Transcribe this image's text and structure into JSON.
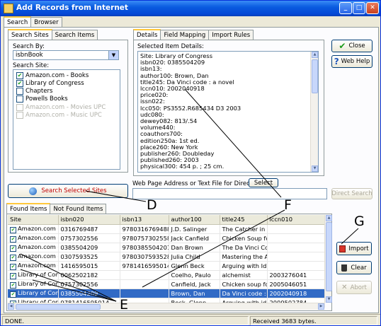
{
  "window": {
    "title": "Add Records from Internet"
  },
  "main_tabs": [
    "Search",
    "Browser"
  ],
  "search_tabs": [
    "Search Sites",
    "Search Items"
  ],
  "search_by": {
    "label": "Search By:",
    "value": "isbnBook"
  },
  "search_site": {
    "label": "Search Site:",
    "sites": [
      {
        "name": "Amazon.com - Books",
        "checked": "✔",
        "enabled": true
      },
      {
        "name": "Library of Congress",
        "checked": "✔",
        "enabled": true
      },
      {
        "name": "Chapters",
        "checked": "",
        "enabled": true
      },
      {
        "name": "Powells Books",
        "checked": "",
        "enabled": true
      },
      {
        "name": "Amazon.com - Movies UPC",
        "checked": "",
        "enabled": false
      },
      {
        "name": "Amazon.com - Music UPC",
        "checked": "",
        "enabled": false
      }
    ]
  },
  "detail_tabs": [
    "Details",
    "Field Mapping",
    "Import Rules"
  ],
  "details": {
    "label": "Selected Item Details:",
    "lines": [
      "Site: Library of Congress",
      "isbn020: 0385504209",
      "isbn13:",
      "author100: Brown, Dan",
      "title245: Da Vinci code : a novel",
      "lccn010: 2002040918",
      "price020:",
      "issn022:",
      "lcc050: PS3552.R685434 D3 2003",
      "udc080:",
      "dewey082: 813/.54",
      "volume440:",
      "coauthors700:",
      "edition250a: 1st ed.",
      "place260: New York",
      "publisher260: Doubleday",
      "published260: 2003",
      "physical300: 454 p. ; 25 cm."
    ]
  },
  "buttons": {
    "close": "Close",
    "web_help": "Web Help",
    "search_selected": "Search Selected Sites",
    "select": "Select",
    "direct_search": "Direct Search",
    "import": "Import",
    "clear": "Clear",
    "abort": "Abort"
  },
  "direct_search": {
    "label": "Web Page Address or Text File for Direct Search:",
    "value": ""
  },
  "result_tabs": [
    "Found Items",
    "Not Found Items"
  ],
  "results": {
    "columns": [
      "Site",
      "isbn020",
      "isbn13",
      "author100",
      "title245",
      "lccn010"
    ],
    "rows": [
      {
        "check": "✔",
        "cells": [
          "Amazon.com -...",
          "0316769487",
          "9780316769488",
          "J.D. Salinger",
          "The Catcher in t...",
          ""
        ],
        "selected": false
      },
      {
        "check": "✔",
        "cells": [
          "Amazon.com -...",
          "0757302556",
          "9780757302558",
          "Jack Canfield",
          "Chicken Soup fo...",
          ""
        ],
        "selected": false
      },
      {
        "check": "✔",
        "cells": [
          "Amazon.com -...",
          "0385504209",
          "9780385504201",
          "Dan Brown",
          "The Da Vinci Co...",
          ""
        ],
        "selected": false
      },
      {
        "check": "✔",
        "cells": [
          "Amazon.com -...",
          "0307593525",
          "9780307593528",
          "Julia Child",
          "Mastering the Ar...",
          ""
        ],
        "selected": false
      },
      {
        "check": "✔",
        "cells": [
          "Amazon.com -...",
          "1416595015",
          "9781416595014",
          "Glenn Beck",
          "Arguing with Idio...",
          ""
        ],
        "selected": false
      },
      {
        "check": "✔",
        "cells": [
          "Library of Con...",
          "0062502182",
          "",
          "Coelho, Paulo",
          "alchemist",
          "2003276041"
        ],
        "selected": false
      },
      {
        "check": "✔",
        "cells": [
          "Library of Con...",
          "0757302556",
          "",
          "Canfield, Jack",
          "Chicken soup fo...",
          "2005046051"
        ],
        "selected": false
      },
      {
        "check": "✔",
        "cells": [
          "Library of Con...",
          "0385504209",
          "",
          "Brown, Dan",
          "Da Vinci code : ...",
          "2002040918"
        ],
        "selected": true
      },
      {
        "check": "✔",
        "cells": [
          "Library of Con...",
          "9781416595014",
          "",
          "Beck, Glenn",
          "Arguing with idio...",
          "2009502784"
        ],
        "selected": false
      }
    ]
  },
  "status": {
    "left": "DONE.",
    "right": "Received 3683 bytes."
  },
  "annotations": {
    "d": "D",
    "e": "E",
    "f": "F",
    "g": "G"
  }
}
